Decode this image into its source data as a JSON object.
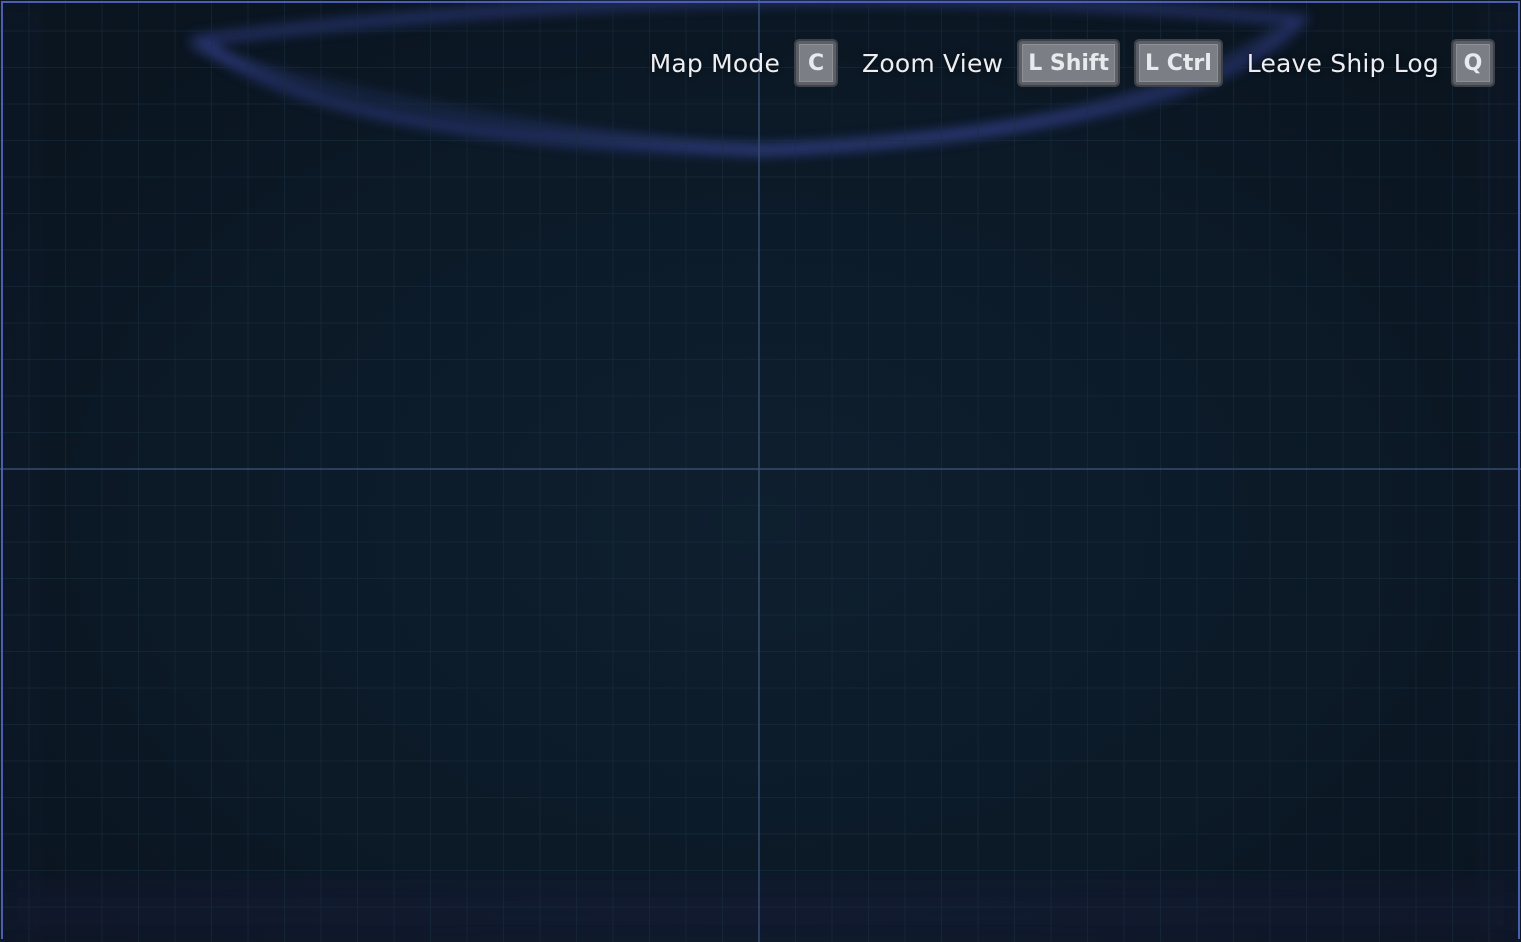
{
  "hud": {
    "map_mode": {
      "label": "Map Mode",
      "key": "C"
    },
    "zoom_view": {
      "label": "Zoom View",
      "key_in": "L Shift",
      "key_out": "L Ctrl"
    },
    "leave_ship_log": {
      "label": "Leave Ship Log",
      "key": "Q"
    }
  },
  "colors": {
    "background": "#0c1a27",
    "grid_line": "#1a2e40",
    "axis_line": "#3a5078",
    "frame": "#4a5fb0",
    "key_fill": "#7b7e85",
    "label_text": "#eceef2"
  }
}
